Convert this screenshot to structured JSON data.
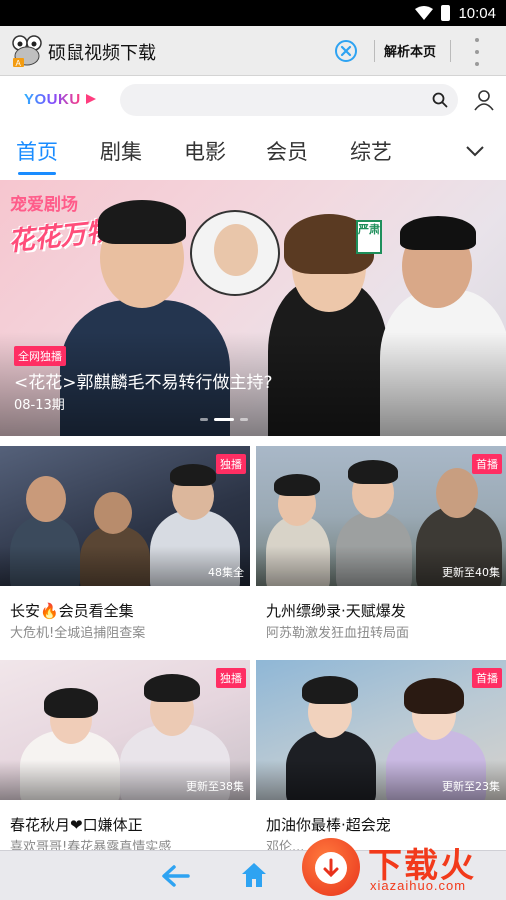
{
  "status_bar": {
    "time": "10:04"
  },
  "app_bar": {
    "title": "硕鼠视频下载",
    "parse_label": "解析本页"
  },
  "youku": {
    "logo_text": "YOUKU",
    "search_placeholder": ""
  },
  "tabs": [
    {
      "label": "首页",
      "active": true
    },
    {
      "label": "剧集",
      "active": false
    },
    {
      "label": "电影",
      "active": false
    },
    {
      "label": "会员",
      "active": false
    },
    {
      "label": "综艺",
      "active": false
    }
  ],
  "banner": {
    "show_tag": "宠爱剧场",
    "show_logo": "花花万物",
    "sign_text": "严肃",
    "badge": "全网独播",
    "title": "<花花>郭麒麟毛不易转行做主持?",
    "date": "08-13期",
    "slide_count": 3,
    "active_slide": 1
  },
  "cards": [
    {
      "badge": "独播",
      "overlay": "48集全",
      "title": "长安🔥会员看全集",
      "subtitle": "大危机!全城追捕阻查案"
    },
    {
      "badge": "首播",
      "overlay": "更新至40集",
      "title": "九州缥缈录·天赋爆发",
      "subtitle": "阿苏勒激发狂血扭转局面"
    },
    {
      "badge": "独播",
      "overlay": "更新至38集",
      "title": "春花秋月❤口嫌体正",
      "subtitle": "喜欢哥哥!春花暴露真情实感"
    },
    {
      "badge": "首播",
      "overlay": "更新至23集",
      "title": "加油你最棒·超会宠",
      "subtitle": "邓伦..."
    }
  ],
  "watermark": {
    "text": "下载火",
    "url": "xiazaihuo.com"
  },
  "colors": {
    "accent": "#1a8cff",
    "badge": "#ff2e63",
    "watermark": "#f23a1b"
  }
}
